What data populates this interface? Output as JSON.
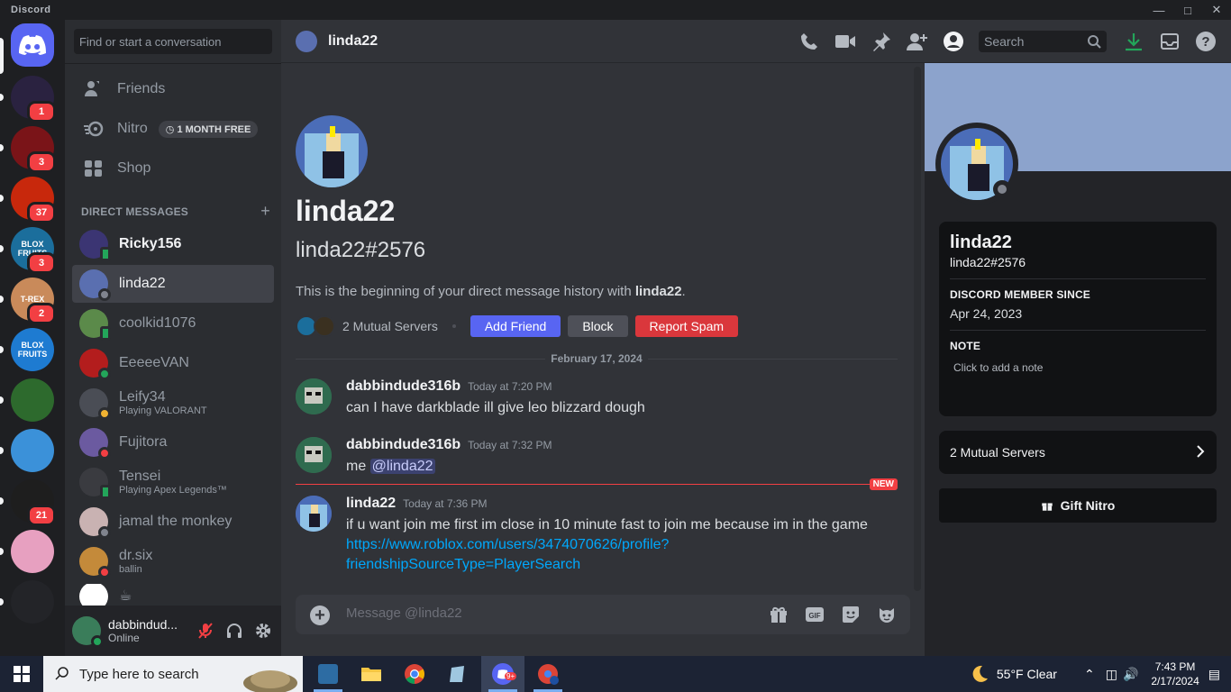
{
  "window": {
    "title": "Discord"
  },
  "rail": {
    "servers": [
      {
        "name": "server-1",
        "badge": "1",
        "color": "#2a2240"
      },
      {
        "name": "server-2",
        "badge": "3",
        "color": "#7a1418"
      },
      {
        "name": "server-3",
        "badge": "37",
        "color": "#c8280c"
      },
      {
        "name": "server-4",
        "badge": "3",
        "color": "#1b6e9c",
        "text": "BLOX FRUITS"
      },
      {
        "name": "server-5",
        "badge": "2",
        "color": "#c98a5a",
        "text": "T-REX"
      },
      {
        "name": "server-6",
        "badge": "",
        "color": "#1e7bd1",
        "text": "BLOX FRUITS"
      },
      {
        "name": "server-7",
        "badge": "",
        "color": "#2d6a2d"
      },
      {
        "name": "server-8",
        "badge": "",
        "color": "#3b91d9"
      },
      {
        "name": "server-9",
        "badge": "21",
        "color": "#1e1e1e"
      },
      {
        "name": "server-10",
        "badge": "",
        "color": "#e7a0c0"
      },
      {
        "name": "server-11",
        "badge": "",
        "color": "#232428"
      }
    ]
  },
  "sidebar": {
    "search_placeholder": "Find or start a conversation",
    "nav": [
      {
        "label": "Friends"
      },
      {
        "label": "Nitro",
        "badge": "1 MONTH FREE"
      },
      {
        "label": "Shop"
      }
    ],
    "dm_header": "DIRECT MESSAGES",
    "dms": [
      {
        "name": "Ricky156",
        "sub": "",
        "status": "mobile",
        "color": "#3b3573"
      },
      {
        "name": "linda22",
        "sub": "",
        "status": "offline",
        "color": "#5a6fb0"
      },
      {
        "name": "coolkid1076",
        "sub": "",
        "status": "mobile",
        "color": "#5b8a4a"
      },
      {
        "name": "EeeeeVAN",
        "sub": "",
        "status": "online",
        "color": "#b31d1d"
      },
      {
        "name": "Leify34",
        "sub": "Playing VALORANT",
        "status": "idle",
        "color": "#4a4d55"
      },
      {
        "name": "Fujitora",
        "sub": "",
        "status": "dnd",
        "color": "#6b5aa0"
      },
      {
        "name": "Tensei",
        "sub": "Playing Apex Legends™",
        "status": "mobile",
        "color": "#3a3b40"
      },
      {
        "name": "jamal the monkey",
        "sub": "",
        "status": "offline",
        "color": "#c9b2b2"
      },
      {
        "name": "dr.six",
        "sub": "ballin",
        "status": "dnd",
        "color": "#c48a3a"
      }
    ]
  },
  "user": {
    "name": "dabbindud...",
    "status": "Online"
  },
  "chat": {
    "header_name": "linda22",
    "search_placeholder": "Search",
    "intro_name": "linda22",
    "intro_tag": "linda22#2576",
    "intro_text": "This is the beginning of your direct message history with ",
    "intro_bold": "linda22",
    "intro_end": ".",
    "mutual": "2 Mutual Servers",
    "add_friend": "Add Friend",
    "block": "Block",
    "report": "Report Spam",
    "date": "February 17, 2024",
    "new_label": "NEW",
    "messages": [
      {
        "author": "dabbindude316b",
        "time": "Today at 7:20 PM",
        "text": "can I have darkblade ill give leo blizzard dough"
      },
      {
        "author": "dabbindude316b",
        "time": "Today at 7:32 PM",
        "text": "me ",
        "mention": "@linda22"
      },
      {
        "author": "linda22",
        "time": "Today at 7:36 PM",
        "text": "if u want join me first im close in 10 minute fast to join me because im in the game",
        "link1": "https://www.roblox.com/users/3474070626/profile?",
        "link2": "friendshipSourceType=PlayerSearch"
      }
    ],
    "composer_placeholder": "Message @linda22"
  },
  "profile": {
    "name": "linda22",
    "tag": "linda22#2576",
    "member_since_label": "DISCORD MEMBER SINCE",
    "member_since": "Apr 24, 2023",
    "note_label": "NOTE",
    "note_placeholder": "Click to add a note",
    "mutual": "2 Mutual Servers",
    "gift": "Gift Nitro",
    "banner_color": "#8ca3cc"
  },
  "taskbar": {
    "search": "Type here to search",
    "weather": "55°F  Clear",
    "time": "7:43 PM",
    "date": "2/17/2024",
    "discord_badge": "9+"
  }
}
